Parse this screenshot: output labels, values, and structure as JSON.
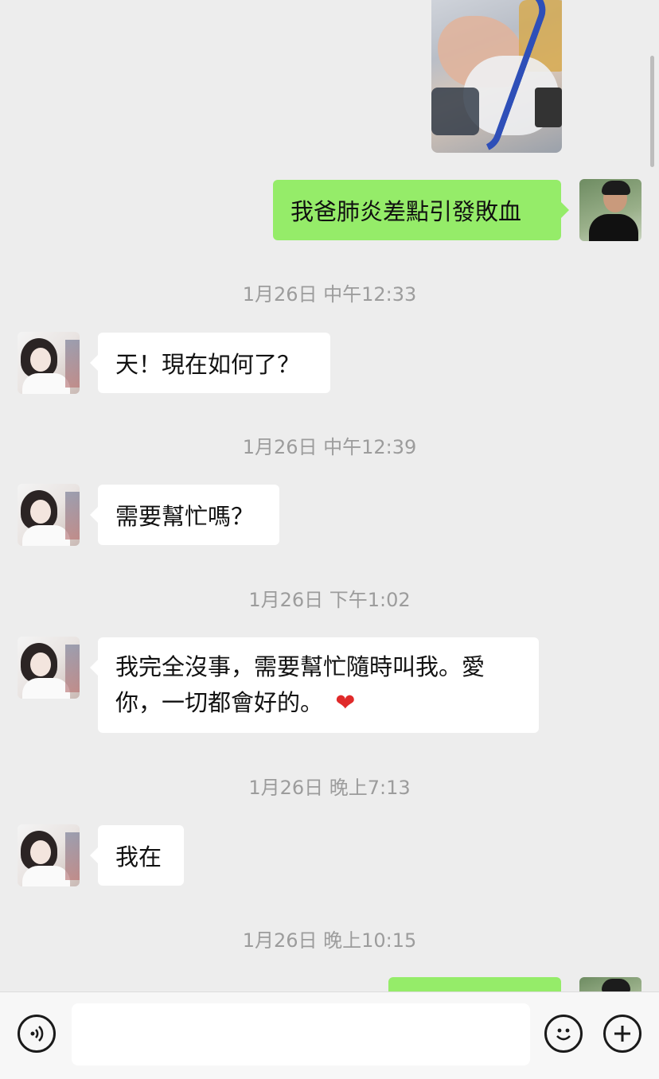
{
  "messages": {
    "m1": "我爸肺炎差點引發敗血",
    "t1": "1月26日 中午12:33",
    "m2": "天！現在如何了？",
    "t2": "1月26日 中午12:39",
    "m3": "需要幫忙嗎？",
    "t3": "1月26日 下午1:02",
    "m4_line1": "我完全沒事，需要幫忙隨時叫我。愛",
    "m4_line2": "你，一切都會好的。",
    "m4_emoji": "❤",
    "t4": "1月26日 晚上7:13",
    "m5": "我在",
    "t5": "1月26日 晚上10:15"
  },
  "colors": {
    "outgoing_bubble": "#95ec69",
    "incoming_bubble": "#ffffff",
    "background": "#ededed"
  },
  "icons": {
    "voice": "voice-icon",
    "emoji": "emoji-icon",
    "add": "plus-icon"
  },
  "input": {
    "placeholder": ""
  }
}
